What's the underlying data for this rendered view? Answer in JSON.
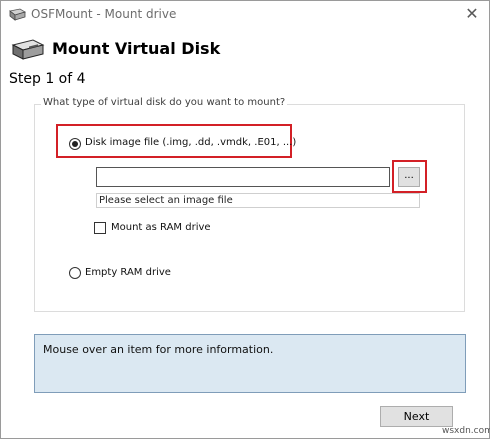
{
  "window": {
    "title": "OSFMount - Mount drive",
    "close_glyph": "✕"
  },
  "header": {
    "title": "Mount Virtual Disk",
    "step": "Step 1 of 4"
  },
  "group": {
    "legend": "What type of virtual disk do you want to mount?",
    "options": [
      {
        "label": "Disk image file (.img, .dd, .vmdk, .E01, ...)",
        "selected": true
      },
      {
        "label": "Empty RAM drive",
        "selected": false
      }
    ],
    "file_input": {
      "value": "",
      "placeholder": ""
    },
    "browse_label": "...",
    "status_text": "Please select an image file",
    "ram_checkbox": {
      "label": "Mount as RAM drive",
      "checked": false
    }
  },
  "info": {
    "text": "Mouse over an item for more information."
  },
  "buttons": {
    "next": "Next"
  },
  "watermark": "wsxdn.com",
  "icons": {
    "app": "drive-icon",
    "header": "disk-drive-icon"
  },
  "colors": {
    "highlight": "#d32026",
    "info_bg": "#dbe8f2",
    "info_border": "#7f9db9",
    "button_bg": "#e1e1e1"
  }
}
